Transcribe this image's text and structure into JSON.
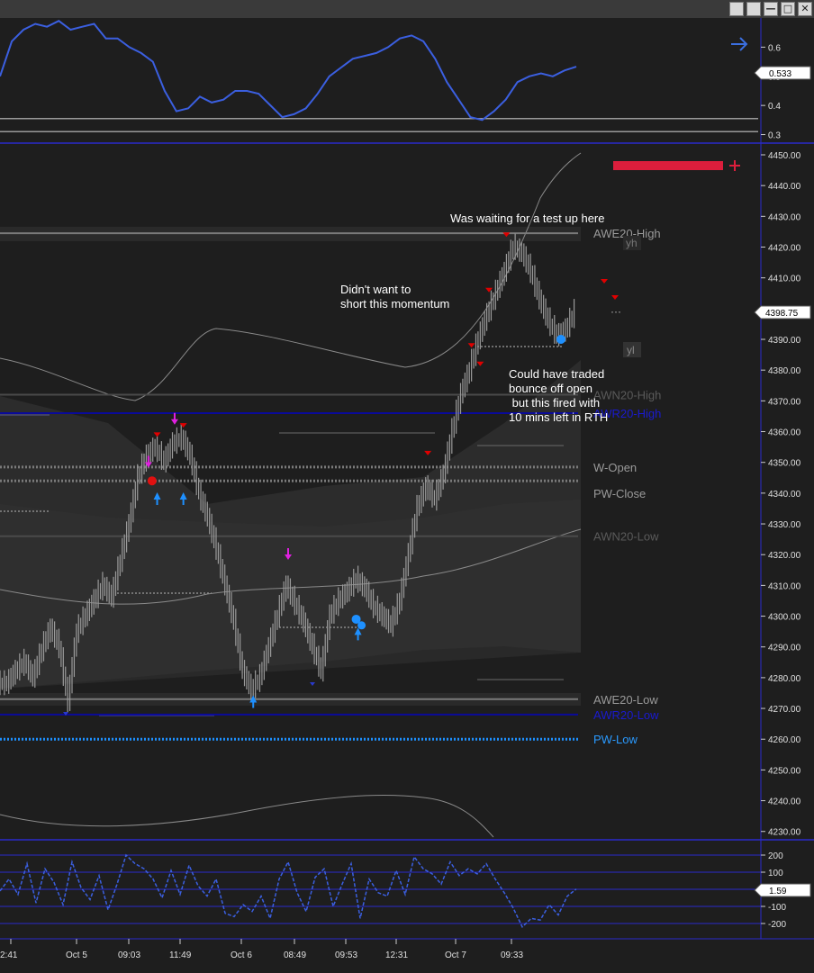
{
  "window": {
    "buttons": [
      {
        "name": "gear-button-a",
        "glyph": ""
      },
      {
        "name": "gear-button-b",
        "glyph": ""
      },
      {
        "name": "minimize-button",
        "glyph": "—"
      },
      {
        "name": "maximize-button",
        "glyph": "□"
      },
      {
        "name": "close-button",
        "glyph": "✕"
      }
    ]
  },
  "colors": {
    "background": "#1e1e1e",
    "price_bars": "#9a9a9a",
    "blue_line": "#3b5fe0",
    "panel_border": "#2a2acc",
    "sell_marker": "#e00000",
    "buy_marker": "#1e90ff",
    "magenta_marker": "#e020e0",
    "position_bar": "#dc1e3c",
    "level_gray": "#7a7a7a",
    "level_dark_gray": "#4a4a4a",
    "level_navy": "#0a0a9a",
    "level_light_blue": "#1e90ff"
  },
  "chart_data": [
    {
      "type": "line",
      "panel": "top-indicator",
      "yticks": [
        0.6,
        0.5,
        0.4,
        0.3
      ],
      "ylim": [
        0.28,
        0.7
      ],
      "current_value_label": "0.533",
      "horizontal_levels": [
        0.355,
        0.31
      ],
      "series": [
        {
          "values": [
            0.5,
            0.62,
            0.66,
            0.68,
            0.67,
            0.69,
            0.66,
            0.67,
            0.68,
            0.63,
            0.63,
            0.6,
            0.58,
            0.55,
            0.45,
            0.38,
            0.39,
            0.43,
            0.41,
            0.42,
            0.45,
            0.45,
            0.44,
            0.4,
            0.36,
            0.37,
            0.39,
            0.44,
            0.5,
            0.53,
            0.56,
            0.57,
            0.58,
            0.6,
            0.63,
            0.64,
            0.62,
            0.56,
            0.48,
            0.42,
            0.36,
            0.35,
            0.38,
            0.42,
            0.48,
            0.5,
            0.51,
            0.5,
            0.52,
            0.533
          ]
        }
      ]
    },
    {
      "type": "line",
      "panel": "price",
      "yticks": [
        4450,
        4440,
        4430,
        4420,
        4410,
        4400,
        4390,
        4380,
        4370,
        4360,
        4350,
        4340,
        4330,
        4320,
        4310,
        4300,
        4290,
        4280,
        4270,
        4260,
        4250,
        4240,
        4230
      ],
      "ylim": [
        4226,
        4452
      ],
      "current_value_label": "4398.75",
      "series": [
        {
          "name": "price",
          "values": [
            4278,
            4282,
            4285,
            4280,
            4289,
            4296,
            4290,
            4272,
            4295,
            4300,
            4305,
            4310,
            4306,
            4318,
            4330,
            4345,
            4352,
            4355,
            4350,
            4356,
            4358,
            4352,
            4340,
            4332,
            4322,
            4310,
            4298,
            4282,
            4276,
            4280,
            4290,
            4300,
            4310,
            4304,
            4298,
            4290,
            4282,
            4300,
            4305,
            4308,
            4312,
            4309,
            4303,
            4300,
            4297,
            4305,
            4320,
            4335,
            4342,
            4338,
            4346,
            4360,
            4372,
            4380,
            4390,
            4398,
            4405,
            4412,
            4420,
            4418,
            4412,
            4403,
            4396,
            4391,
            4393,
            4398.75
          ]
        }
      ],
      "levels": [
        {
          "label": "AWE20-High",
          "value": 4424.5,
          "style": "solid",
          "color": "#7a7a7a"
        },
        {
          "label": "AWN20-High",
          "value": 4372,
          "style": "solid",
          "color": "#4a4a4a"
        },
        {
          "label": "AWR20-High",
          "value": 4366,
          "style": "solid",
          "color": "#0a0a9a"
        },
        {
          "label": "W-Open",
          "value": 4348.5,
          "style": "dotted",
          "color": "#7a7a7a"
        },
        {
          "label": "PW-Close",
          "value": 4344,
          "style": "dotted",
          "color": "#7a7a7a"
        },
        {
          "label": "AWN20-Low",
          "value": 4326,
          "style": "solid",
          "color": "#4a4a4a"
        },
        {
          "label": "AWE20-Low",
          "value": 4273,
          "style": "solid",
          "color": "#7a7a7a"
        },
        {
          "label": "AWR20-Low",
          "value": 4268,
          "style": "solid",
          "color": "#0a0a9a"
        },
        {
          "label": "PW-Low",
          "value": 4260,
          "style": "dotted",
          "color": "#1e90ff"
        }
      ],
      "small_labels": {
        "yh": "yh",
        "yl": "yl"
      },
      "annotations": [
        {
          "lines": [
            "Was waiting for a test up here"
          ]
        },
        {
          "lines": [
            "Didn't want to",
            "short this momentum"
          ]
        },
        {
          "lines": [
            "Could have traded",
            "bounce off open",
            " but this fired with",
            "10 mins left in RTH"
          ]
        }
      ]
    },
    {
      "type": "line",
      "panel": "bottom-oscillator",
      "yticks": [
        200,
        100,
        -100,
        -200
      ],
      "ylim": [
        -280,
        280
      ],
      "current_value_label": "1.59",
      "series": [
        {
          "values": [
            -10,
            60,
            -30,
            150,
            -80,
            120,
            40,
            -90,
            160,
            10,
            -60,
            80,
            -120,
            30,
            200,
            150,
            120,
            60,
            -50,
            110,
            -30,
            140,
            20,
            -40,
            60,
            -140,
            -160,
            -90,
            -130,
            -40,
            -170,
            60,
            160,
            -20,
            -130,
            70,
            120,
            -100,
            30,
            150,
            -170,
            60,
            -20,
            -40,
            110,
            -30,
            190,
            120,
            90,
            30,
            160,
            80,
            120,
            90,
            150,
            60,
            -20,
            -110,
            -220,
            -170,
            -180,
            -90,
            -150,
            -40,
            1.59
          ]
        }
      ]
    }
  ],
  "time_axis": {
    "labels": [
      "2:41",
      "Oct 5",
      "09:03",
      "11:49",
      "Oct 6",
      "08:49",
      "09:53",
      "12:31",
      "Oct 7",
      "09:33"
    ]
  }
}
